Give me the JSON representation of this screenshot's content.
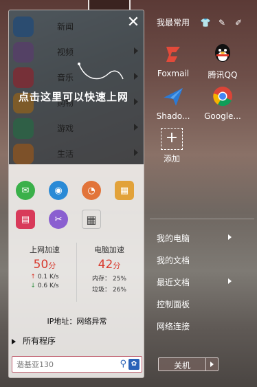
{
  "categories": [
    {
      "label": "新闻",
      "icon": "news-icon",
      "color": "#2f78c8"
    },
    {
      "label": "视频",
      "icon": "video-icon",
      "color": "#8b5fb0"
    },
    {
      "label": "音乐",
      "icon": "music-icon",
      "color": "#d53a4c"
    },
    {
      "label": "购物",
      "icon": "shopping-icon",
      "color": "#e59a2c"
    },
    {
      "label": "游戏",
      "icon": "game-icon",
      "color": "#38a36a"
    },
    {
      "label": "生活",
      "icon": "life-icon",
      "color": "#e5842a"
    }
  ],
  "tip_text": "点击这里可以快速上网",
  "quick_icons": [
    {
      "icon": "wechat-icon",
      "color": "#3ab04a",
      "glyph": "✉"
    },
    {
      "icon": "wifi-icon",
      "color": "#2a8ad6",
      "glyph": "◉"
    },
    {
      "icon": "speed-icon",
      "color": "#e2743a",
      "glyph": "◔"
    },
    {
      "icon": "calculator-icon",
      "color": "#e2a23a",
      "glyph": "▦"
    },
    {
      "icon": "notes-icon",
      "color": "#d83a5a",
      "glyph": "▤"
    },
    {
      "icon": "scissors-icon",
      "color": "#8a5fd0",
      "glyph": "✂"
    },
    {
      "icon": "grid-icon",
      "color": "#555555",
      "glyph": "▦"
    }
  ],
  "stats": {
    "net_title": "上网加速",
    "net_score": "50",
    "score_unit": "分",
    "upload": "0.1 K/s",
    "download": "0.6 K/s",
    "pc_title": "电脑加速",
    "pc_score": "42",
    "memory_label": "内存：",
    "memory_value": "25%",
    "junk_label": "垃圾：",
    "junk_value": "26%"
  },
  "ip_text": "IP地址：网络异常",
  "all_programs": "所有程序",
  "search": {
    "value": "",
    "placeholder": "谐基亚130"
  },
  "right": {
    "header": "我最常用",
    "apps": [
      {
        "label": "Foxmail",
        "icon": "foxmail-icon"
      },
      {
        "label": "腾讯QQ",
        "icon": "qq-icon"
      },
      {
        "label": "Shado...",
        "icon": "shadowsocks-icon"
      },
      {
        "label": "Google...",
        "icon": "chrome-icon"
      }
    ],
    "add_label": "添加",
    "links": [
      "我的电脑",
      "我的文档",
      "最近文档",
      "控制面板",
      "网络连接"
    ],
    "shutdown": "关机"
  }
}
